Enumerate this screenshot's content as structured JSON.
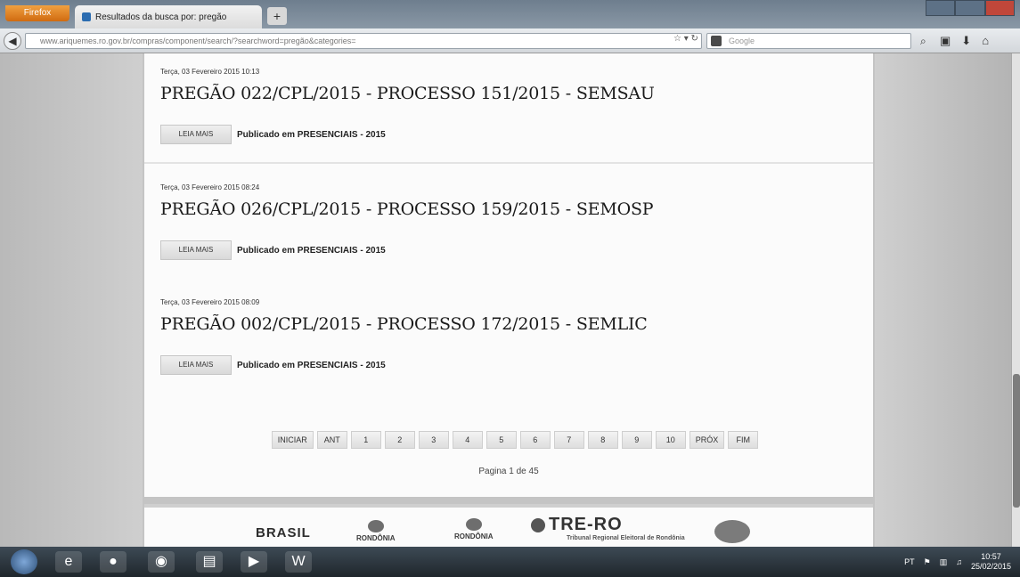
{
  "browser": {
    "firefox_label": "Firefox",
    "tab_title": "Resultados da busca por: pregão",
    "url": "www.ariquemes.ro.gov.br/compras/component/search/?searchword=pregão&categories=",
    "search_placeholder": "Google"
  },
  "results": [
    {
      "date": "Terça, 03 Fevereiro 2015 10:13",
      "title": "PREGÃO 022/CPL/2015 - PROCESSO 151/2015 - SEMSAU",
      "read_more": "LEIA MAIS",
      "published_label": "Publicado em",
      "category": "PRESENCIAIS - 2015"
    },
    {
      "date": "Terça, 03 Fevereiro 2015 08:24",
      "title": "PREGÃO 026/CPL/2015 - PROCESSO 159/2015 - SEMOSP",
      "read_more": "LEIA MAIS",
      "published_label": "Publicado em",
      "category": "PRESENCIAIS - 2015"
    },
    {
      "date": "Terça, 03 Fevereiro 2015 08:09",
      "title": "PREGÃO 002/CPL/2015 - PROCESSO 172/2015 - SEMLIC",
      "read_more": "LEIA MAIS",
      "published_label": "Publicado em",
      "category": "PRESENCIAIS - 2015"
    }
  ],
  "pagination": {
    "first": "INICIAR",
    "prev": "ANT",
    "pages": [
      "1",
      "2",
      "3",
      "4",
      "5",
      "6",
      "7",
      "8",
      "9",
      "10"
    ],
    "next": "PRÓX",
    "last": "FIM",
    "info": "Pagina 1 de 45"
  },
  "footer": {
    "logo_brasil": "BRASIL",
    "logo_rondonia_1": "RONDÔNIA",
    "logo_rondonia_2": "RONDÔNIA",
    "logo_tre": "TRE-RO",
    "logo_tre_sub": "Tribunal Regional Eleitoral de Rondônia"
  },
  "taskbar": {
    "lang": "PT",
    "time": "10:57",
    "date": "25/02/2015"
  }
}
